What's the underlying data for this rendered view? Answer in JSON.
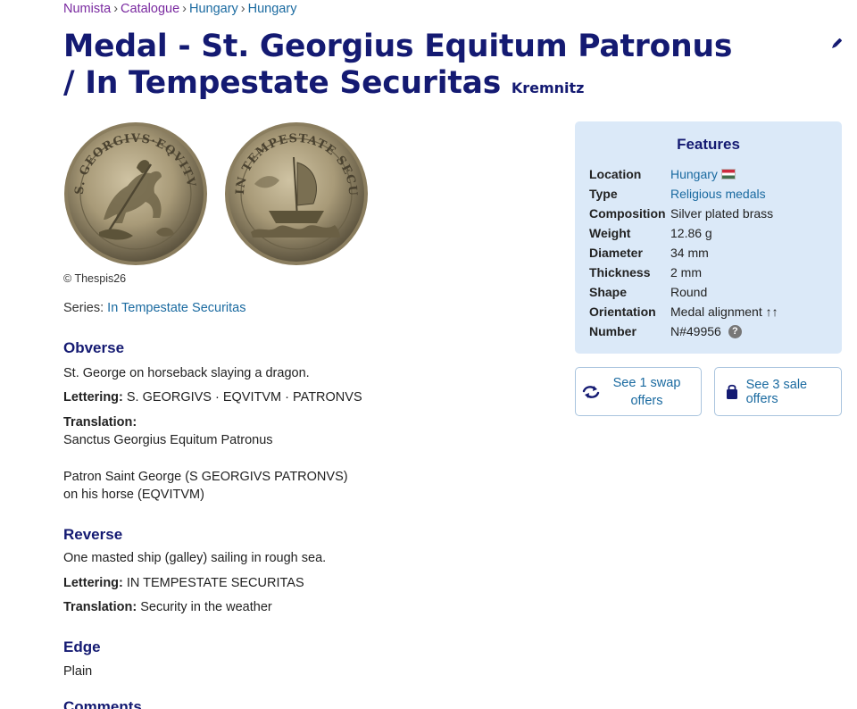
{
  "breadcrumb": [
    {
      "label": "Numista"
    },
    {
      "label": "Catalogue"
    },
    {
      "label": "Hungary"
    },
    {
      "label": "Hungary"
    }
  ],
  "breadcrumb_sep": "›",
  "title": {
    "main": "Medal - St. Georgius Equitum Patronus / In Tempestate Securitas",
    "mint": "Kremnitz"
  },
  "images": {
    "copyright": "© Thespis26",
    "obverse_legend": "S. GEORGIVS·EQVITVM·PATRONVS",
    "reverse_legend": "IN TEMPESTATE SECURITAS"
  },
  "series": {
    "label": "Series:",
    "value": "In Tempestate Securitas"
  },
  "obverse": {
    "heading": "Obverse",
    "description": "St. George on horseback slaying a dragon.",
    "lettering_label": "Lettering:",
    "lettering": "S. GEORGIVS · EQVITVM · PATRONVS",
    "translation_label": "Translation:",
    "translation": "Sanctus Georgius Equitum Patronus",
    "note_line1": "Patron Saint George (S GEORGIVS PATRONVS)",
    "note_line2": "on his horse (EQVITVM)"
  },
  "reverse": {
    "heading": "Reverse",
    "description": "One masted ship (galley) sailing in rough sea.",
    "lettering_label": "Lettering:",
    "lettering": "IN TEMPESTATE SECURITAS",
    "translation_label": "Translation:",
    "translation": "Security in the weather"
  },
  "edge": {
    "heading": "Edge",
    "value": "Plain"
  },
  "comments": {
    "heading": "Comments"
  },
  "features": {
    "heading": "Features",
    "rows": [
      {
        "key": "Location",
        "value": "Hungary",
        "icon": "hungary-flag"
      },
      {
        "key": "Type",
        "value": "Religious medals"
      },
      {
        "key": "Composition",
        "value": "Silver plated brass"
      },
      {
        "key": "Weight",
        "value": "12.86 g"
      },
      {
        "key": "Diameter",
        "value": "34 mm"
      },
      {
        "key": "Thickness",
        "value": "2 mm"
      },
      {
        "key": "Shape",
        "value": "Round"
      },
      {
        "key": "Orientation",
        "value": "Medal alignment ↑↑"
      },
      {
        "key": "Number",
        "value": "N#49956",
        "icon": "help-icon"
      }
    ],
    "help_glyph": "?"
  },
  "offers": {
    "swap_line1": "See 1 swap",
    "swap_line2": "offers",
    "sale": "See 3 sale offers"
  },
  "colors": {
    "title": "#141a72",
    "link": "#1a6aa0",
    "visited": "#7a2aa0",
    "features_bg": "#dbe9f8"
  }
}
